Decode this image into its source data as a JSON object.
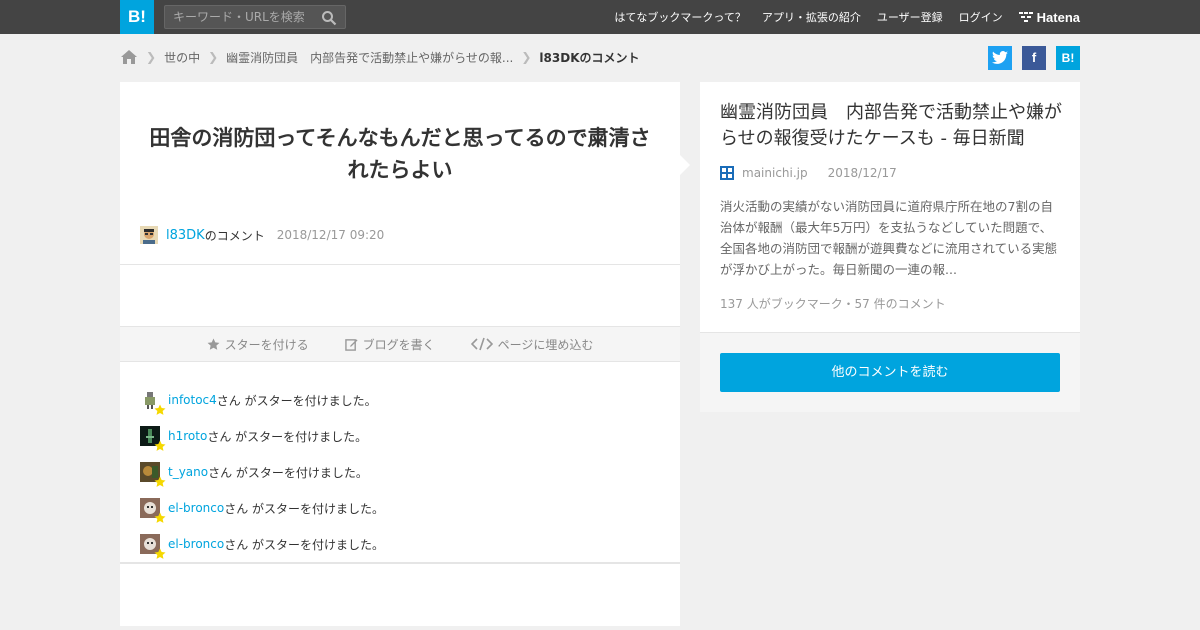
{
  "header": {
    "logo": "B!",
    "search_placeholder": "キーワード・URLを検索",
    "nav": [
      "はてなブックマークって？",
      "アプリ・拡張の紹介",
      "ユーザー登録",
      "ログイン"
    ],
    "brand": "Hatena"
  },
  "breadcrumb": {
    "items": [
      "世の中",
      "幽霊消防団員　内部告発で活動禁止や嫌がらせの報..."
    ],
    "current": "l83DKのコメント"
  },
  "share": {
    "twitter": "t",
    "facebook": "f",
    "hatena": "B!"
  },
  "comment": {
    "text": "田舎の消防団ってそんなもんだと思ってるので粛清されたらよい",
    "user": "l83DK",
    "user_suffix": "のコメント",
    "date": "2018/12/17 09:20"
  },
  "actions": {
    "star": "スターを付ける",
    "blog": "ブログを書く",
    "embed": "ページに埋め込む"
  },
  "stars": [
    {
      "user": "infotoc4",
      "text": "さん がスターを付けました。"
    },
    {
      "user": "h1roto",
      "text": "さん がスターを付けました。"
    },
    {
      "user": "t_yano",
      "text": "さん がスターを付けました。"
    },
    {
      "user": "el-bronco",
      "text": "さん がスターを付けました。"
    },
    {
      "user": "el-bronco",
      "text": "さん がスターを付けました。"
    }
  ],
  "article": {
    "title": "幽霊消防団員　内部告発で活動禁止や嫌がらせの報復受けたケースも - 毎日新聞",
    "domain": "mainichi.jp",
    "date": "2018/12/17",
    "description": "消火活動の実績がない消防団員に道府県庁所在地の7割の自治体が報酬（最大年5万円）を支払うなどしていた問題で、全国各地の消防団で報酬が遊興費などに流用されている実態が浮かび上がった。毎日新聞の一連の報...",
    "counts": "137 人がブックマーク・57 件のコメント",
    "read_button": "他のコメントを読む"
  },
  "colors": {
    "accent": "#00a4de",
    "header_bg": "#444444",
    "star": "#f5d800"
  }
}
